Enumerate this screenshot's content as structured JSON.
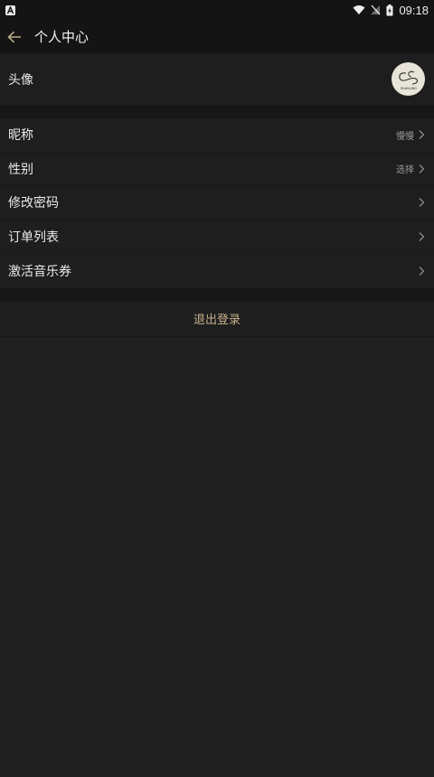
{
  "status_bar": {
    "notification_icon": "android-a-icon",
    "time": "09:18",
    "icons": [
      "wifi-icon",
      "no-signal-icon",
      "battery-charging-icon"
    ]
  },
  "header": {
    "title": "个人中心",
    "back_icon": "arrow-left-icon"
  },
  "avatar_row": {
    "label": "头像",
    "avatar_brand": "SHANLING"
  },
  "settings": [
    {
      "label": "昵称",
      "value": "慢慢"
    },
    {
      "label": "性别",
      "value": "选择"
    },
    {
      "label": "修改密码",
      "value": ""
    },
    {
      "label": "订单列表",
      "value": ""
    },
    {
      "label": "激活音乐券",
      "value": ""
    }
  ],
  "logout": {
    "label": "退出登录"
  },
  "colors": {
    "background": "#202020",
    "bar": "#141414",
    "accent": "#c9b38c"
  }
}
